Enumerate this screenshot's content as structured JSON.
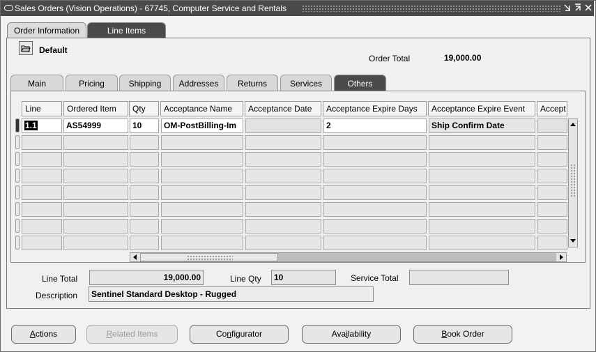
{
  "window": {
    "title": "Sales Orders (Vision Operations) - 67745, Computer Service and Rentals",
    "controls": [
      "minimize-icon",
      "maximize-icon",
      "close-icon"
    ]
  },
  "tabs": [
    {
      "label": "Order Information",
      "active": false
    },
    {
      "label": "Line Items",
      "active": true
    }
  ],
  "folder": {
    "label": "Default"
  },
  "order_total": {
    "label": "Order Total",
    "value": "19,000.00"
  },
  "subtabs": [
    {
      "label": "Main",
      "active": false
    },
    {
      "label": "Pricing",
      "active": false
    },
    {
      "label": "Shipping",
      "active": false
    },
    {
      "label": "Addresses",
      "active": false
    },
    {
      "label": "Returns",
      "active": false
    },
    {
      "label": "Services",
      "active": false
    },
    {
      "label": "Others",
      "active": true
    }
  ],
  "grid": {
    "columns": [
      "Line",
      "Ordered Item",
      "Qty",
      "Acceptance Name",
      "Acceptance Date",
      "Acceptance Expire Days",
      "Acceptance Expire Event",
      "Accept"
    ],
    "rows": [
      [
        "1.1",
        "AS54999",
        "10",
        "OM-PostBilling-Im",
        "",
        "2",
        "Ship Confirm Date",
        ""
      ]
    ]
  },
  "summary": {
    "line_total_label": "Line Total",
    "line_total": "19,000.00",
    "line_qty_label": "Line Qty",
    "line_qty": "10",
    "service_total_label": "Service Total",
    "service_total": "",
    "description_label": "Description",
    "description": "Sentinel Standard Desktop - Rugged"
  },
  "buttons": [
    {
      "label": "Actions",
      "mnemonic": "A",
      "rest": "ctions",
      "enabled": true
    },
    {
      "label": "Related Items",
      "mnemonic": "R",
      "rest": "elated Items",
      "enabled": false
    },
    {
      "label": "Configurator",
      "mnemonic": "n",
      "pre": "Co",
      "rest": "figurator",
      "enabled": true
    },
    {
      "label": "Availability",
      "mnemonic": "i",
      "pre": "Ava",
      "rest": "lability",
      "enabled": true
    },
    {
      "label": "Book Order",
      "mnemonic": "B",
      "rest": "ook Order",
      "enabled": true
    }
  ]
}
